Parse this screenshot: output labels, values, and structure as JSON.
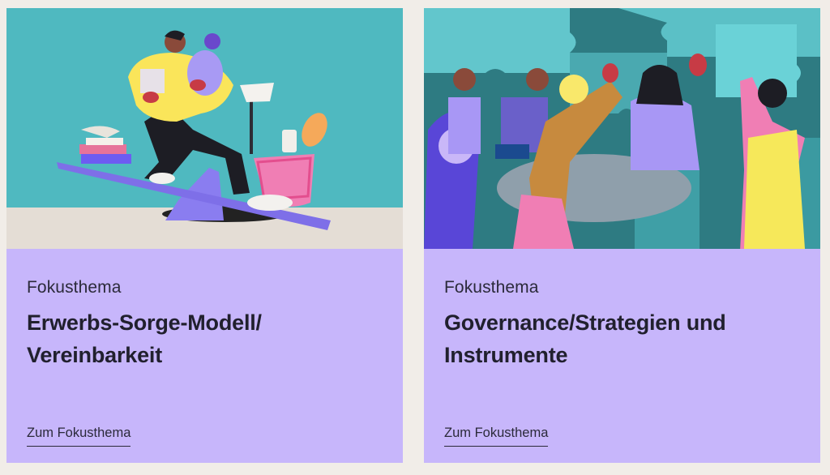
{
  "cards": [
    {
      "eyebrow": "Fokusthema",
      "title": "Erwerbs-Sorge-Modell/ Vereinbarkeit",
      "link": "Zum Fokusthema",
      "illustration": "person-balancing-work-and-care-on-seesaw"
    },
    {
      "eyebrow": "Fokusthema",
      "title": "Governance/Strategien und Instrumente",
      "link": "Zum Fokusthema",
      "illustration": "people-meeting-puzzle-pieces"
    }
  ],
  "colors": {
    "page_bg": "#f1ede8",
    "card_bg": "#c7b6fb",
    "illustration_1_bg": "#4fb9c0",
    "illustration_2_bg": "#2e7b82"
  }
}
